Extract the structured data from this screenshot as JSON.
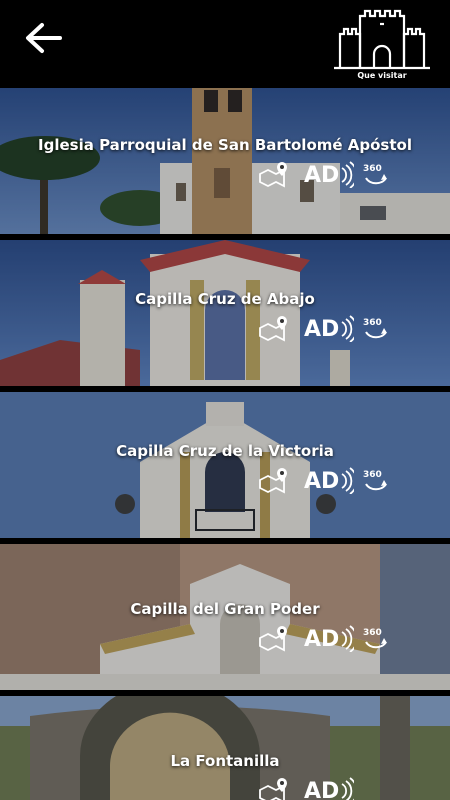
{
  "header": {
    "back_label": "",
    "section_label": "Que visitar"
  },
  "places": [
    {
      "title": "Iglesia Parroquial de San Bartolomé Apóstol",
      "has_360": true
    },
    {
      "title": "Capilla Cruz de Abajo",
      "has_360": true
    },
    {
      "title": "Capilla Cruz de la Victoria",
      "has_360": true
    },
    {
      "title": "Capilla del Gran Poder",
      "has_360": true
    },
    {
      "title": "La Fontanilla",
      "has_360": false
    }
  ],
  "badges": {
    "audio_description": "AD",
    "view_360": "360"
  },
  "icons": [
    "back-arrow-icon",
    "castle-icon",
    "map-pin-icon",
    "audio-description-icon",
    "360-view-icon"
  ],
  "colors": {
    "background": "#000000",
    "text": "#ffffff"
  }
}
